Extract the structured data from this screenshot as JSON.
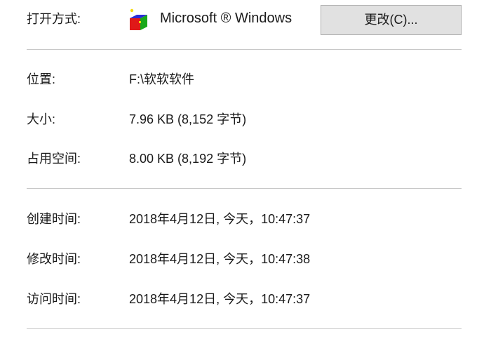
{
  "open_with": {
    "label": "打开方式:",
    "app_icon": "windows-app-cube-icon",
    "app_name": "Microsoft ® Windows",
    "change_button": "更改(C)..."
  },
  "location": {
    "label": "位置:",
    "value": "F:\\软软软件"
  },
  "size": {
    "label": "大小:",
    "value": "7.96 KB (8,152 字节)"
  },
  "size_on_disk": {
    "label": "占用空间:",
    "value": "8.00 KB (8,192 字节)"
  },
  "created": {
    "label": "创建时间:",
    "value": "2018年4月12日, 今天，10:47:37"
  },
  "modified": {
    "label": "修改时间:",
    "value": "2018年4月12日, 今天，10:47:38"
  },
  "accessed": {
    "label": "访问时间:",
    "value": "2018年4月12日, 今天，10:47:37"
  },
  "colors": {
    "button_bg": "#e1e1e1",
    "button_border": "#adadad",
    "divider": "#c8c8c8"
  }
}
